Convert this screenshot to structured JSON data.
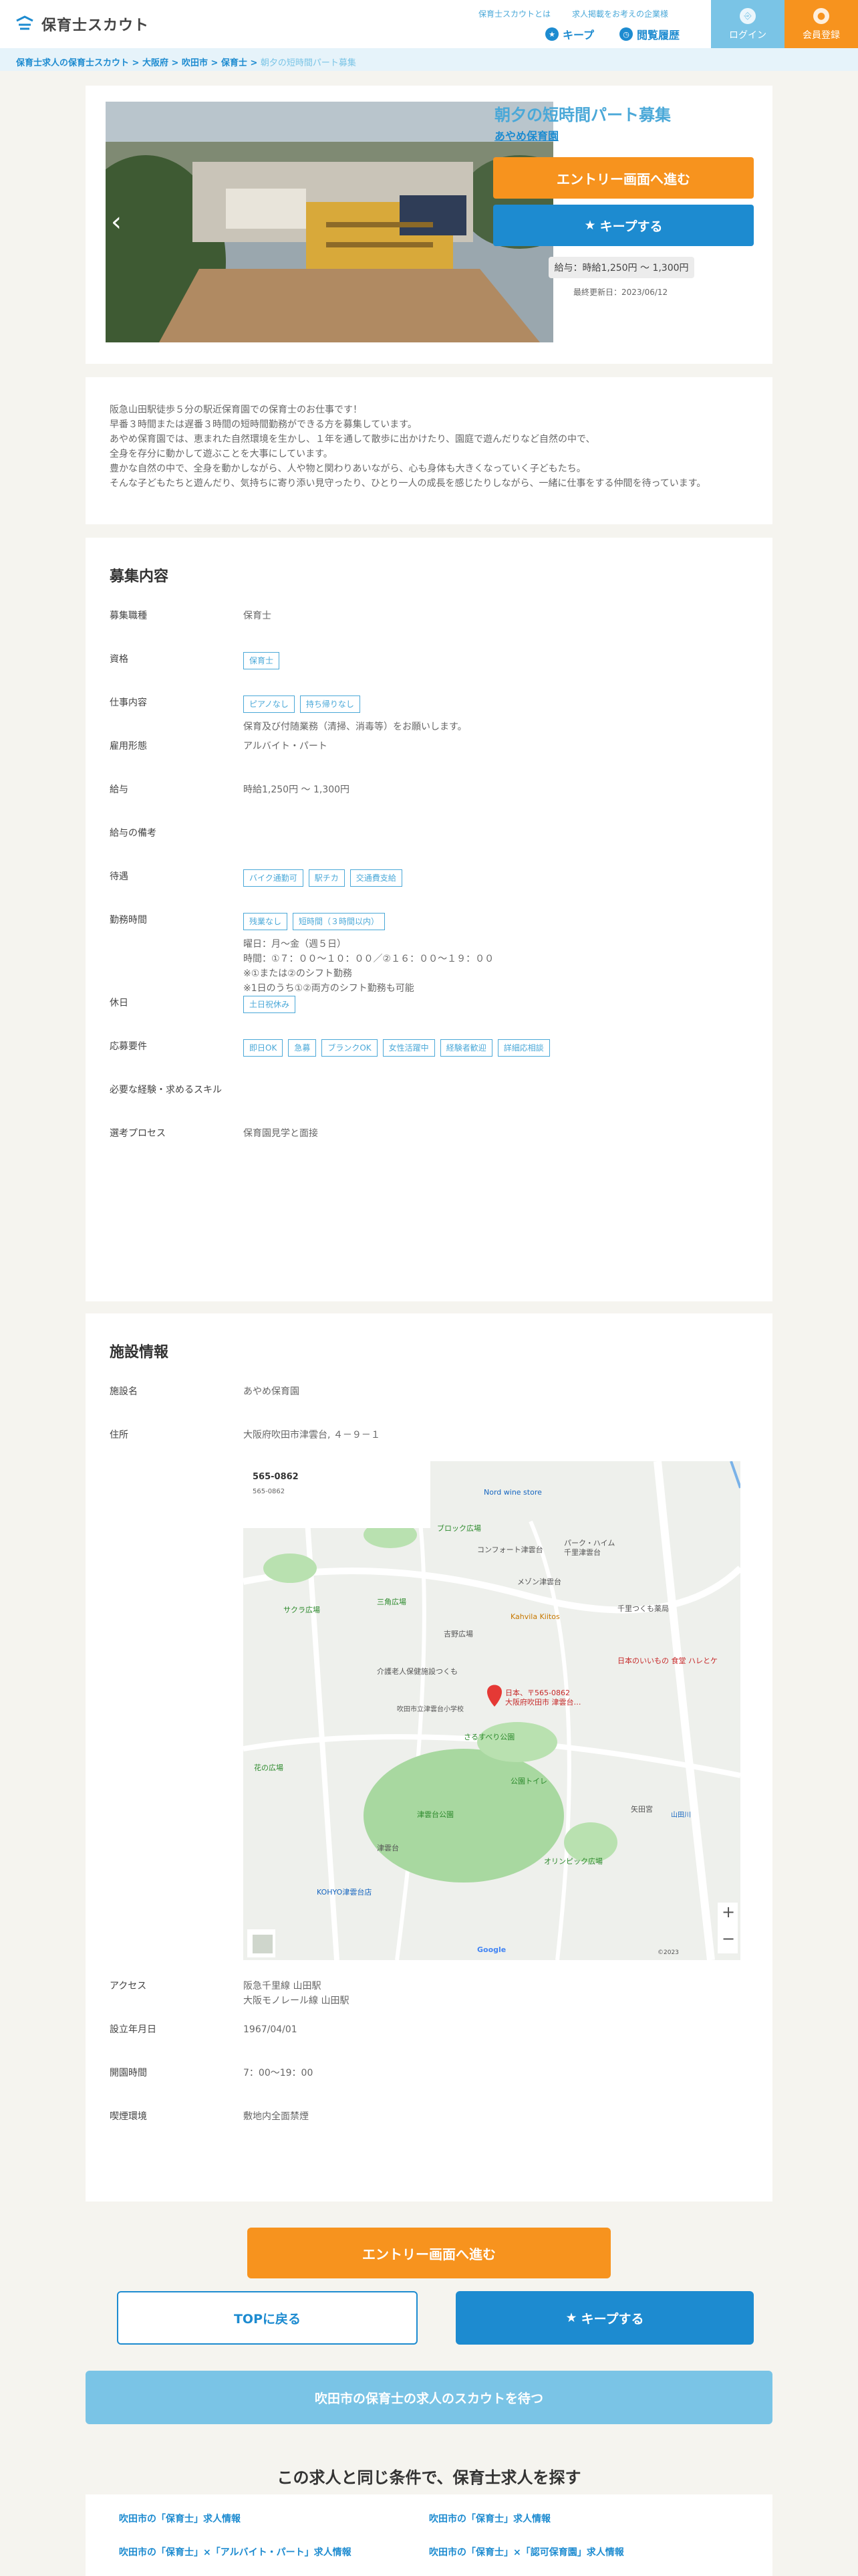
{
  "header": {
    "logo": "保育士スカウト",
    "links_small": [
      "保育士スカウトとは",
      "求人掲載をお考えの企業様"
    ],
    "keep": "キープ",
    "history": "閲覧履歴",
    "login": "ログイン",
    "register": "会員登録"
  },
  "breadcrumb": {
    "items": [
      "保育士求人の保育士スカウト",
      "大阪府",
      "吹田市",
      "保育士"
    ],
    "current": "朝夕の短時間パート募集",
    "sep": " > "
  },
  "job": {
    "title": "朝夕の短時間パート募集",
    "facility": "あやめ保育園",
    "entry": "エントリー画面へ進む",
    "keep": "キープする",
    "salary": "給与：時給1,250円 〜 1,300円",
    "updated": "最終更新日：2023/06/12"
  },
  "intro": [
    "阪急山田駅徒歩５分の駅近保育園での保育士のお仕事です！",
    "早番３時間または遅番３時間の短時間勤務ができる方を募集しています。",
    "あやめ保育園では、恵まれた自然環境を生かし、１年を通して散歩に出かけたり、園庭で遊んだりなど自然の中で、",
    "全身を存分に動かして遊ぶことを大事にしています。",
    "豊かな自然の中で、全身を動かしながら、人や物と関わりあいながら、心も身体も大きくなっていく子どもたち。",
    "そんな子どもたちと遊んだり、気持ちに寄り添い見守ったり、ひとり一人の成長を感じたりしながら、一緒に仕事をする仲間を待っています。"
  ],
  "recruit": {
    "heading": "募集内容",
    "rows": [
      {
        "label": "募集職種",
        "tags": [],
        "text": [
          "保育士"
        ]
      },
      {
        "label": "資格",
        "tags": [
          "保育士"
        ],
        "text": []
      },
      {
        "label": "仕事内容",
        "tags": [
          "ピアノなし",
          "持ち帰りなし"
        ],
        "text": [
          "保育及び付随業務（清掃、消毒等）をお願いします。"
        ]
      },
      {
        "label": "雇用形態",
        "tags": [],
        "text": [
          "アルバイト・パート"
        ]
      },
      {
        "label": "給与",
        "tags": [],
        "text": [
          "時給1,250円 〜 1,300円"
        ]
      },
      {
        "label": "給与の備考",
        "tags": [],
        "text": []
      },
      {
        "label": "待遇",
        "tags": [
          "バイク通勤可",
          "駅チカ",
          "交通費支給"
        ],
        "text": []
      },
      {
        "label": "勤務時間",
        "tags": [
          "残業なし",
          "短時間（３時間以内）"
        ],
        "text": [
          "曜日：月〜金（週５日）",
          "時間：①７：００〜１０：００／②１６：００〜１９：００",
          "※①または②のシフト勤務",
          "※1日のうち①②両方のシフト勤務も可能"
        ]
      },
      {
        "label": "休日",
        "tags": [
          "土日祝休み"
        ],
        "text": []
      },
      {
        "label": "応募要件",
        "tags": [
          "即日OK",
          "急募",
          "ブランクOK",
          "女性活躍中",
          "経験者歓迎",
          "詳細応相談"
        ],
        "text": []
      },
      {
        "label": "必要な経験・求めるスキル",
        "tags": [],
        "text": []
      },
      {
        "label": "選考プロセス",
        "tags": [],
        "text": [
          "保育園見学と面接"
        ]
      }
    ]
  },
  "facility": {
    "heading": "施設情報",
    "name_label": "施設名",
    "name": "あやめ保育園",
    "addr_label": "住所",
    "address": "大阪府吹田市津雲台, ４－９－１",
    "map": {
      "postal": "565-0862",
      "pin": "日本、〒565-0862",
      "pin2": "大阪府吹田市 津雲台…",
      "labels": [
        "ブロック広場",
        "コンフォート津雲台",
        "パーク・ハイム",
        "千里津雲台",
        "サクラ広場",
        "三角広場",
        "Kahvila Kiitos",
        "メゾン津雲台",
        "千里つくも薬局",
        "日本のいいもの 食堂 ハレとケ",
        "介護老人保健施設つくも",
        "吹田市立津雲台小学校",
        "さるすべり公園",
        "津雲台",
        "花の広場",
        "公園トイレ",
        "吉野広場",
        "津雲台公園",
        "矢田宮",
        "オリンピック広場",
        "KOHYO津雲台店",
        "山田川",
        "Nord wine store"
      ],
      "google": "Google",
      "copy": "©2023"
    },
    "rows": [
      {
        "label": "アクセス",
        "text": [
          "阪急千里線 山田駅",
          "大阪モノレール線 山田駅"
        ]
      },
      {
        "label": "設立年月日",
        "text": [
          "1967/04/01"
        ]
      },
      {
        "label": "開園時間",
        "text": [
          "7：00〜19：00"
        ]
      },
      {
        "label": "喫煙環境",
        "text": [
          "敷地内全面禁煙"
        ]
      }
    ]
  },
  "actions": {
    "entry": "エントリー画面へ進む",
    "top": "TOPに戻る",
    "keep": "キープする",
    "scout": "吹田市の保育士の求人のスカウトを待つ"
  },
  "search": {
    "heading": "この求人と同じ条件で、保育士求人を探す",
    "links": [
      "吹田市の「保育士」求人情報",
      "吹田市の「保育士」求人情報",
      "吹田市の「保育士」×「アルバイト・パート」求人情報",
      "吹田市の「保育士」×「認可保育園」求人情報"
    ]
  },
  "colors": {
    "orange": "#f7931e",
    "blue": "#1d8bd0",
    "lightblue": "#7ac4e6",
    "bg": "#f5f4ef"
  }
}
